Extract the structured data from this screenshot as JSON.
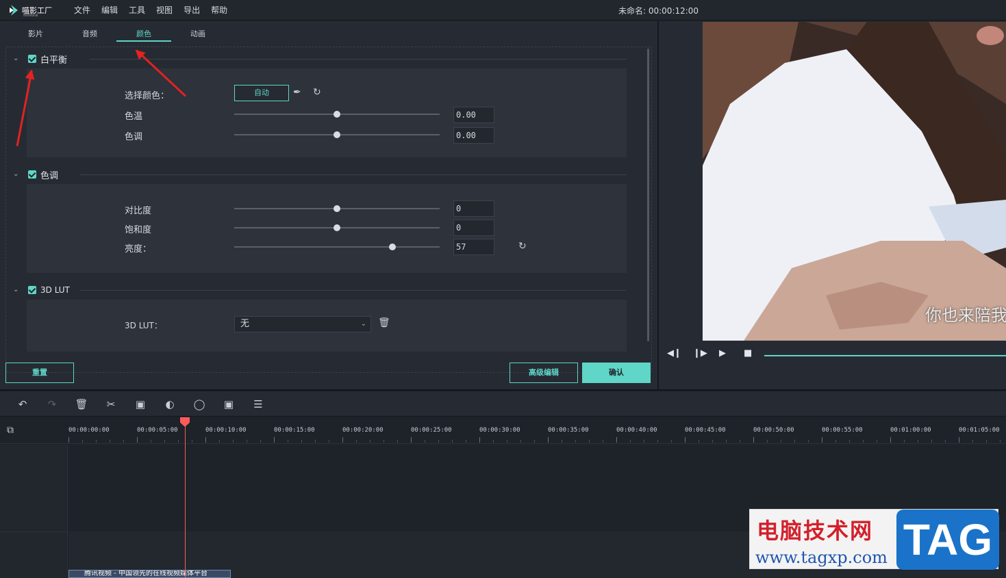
{
  "app": {
    "logo_text": "喵影工厂",
    "logo_sub": "filmora",
    "project_title": "未命名: 00:00:12:00"
  },
  "menu": [
    "文件",
    "编辑",
    "工具",
    "视图",
    "导出",
    "帮助"
  ],
  "tabs": [
    {
      "label": "影片",
      "active": false
    },
    {
      "label": "音频",
      "active": false
    },
    {
      "label": "颜色",
      "active": true
    },
    {
      "label": "动画",
      "active": false
    }
  ],
  "white_balance": {
    "title": "白平衡",
    "checked": true,
    "pick_color_label": "选择颜色：",
    "auto_label": "自动",
    "temperature_label": "色温",
    "temperature_value": "0.00",
    "temperature_level": 0.5,
    "tint_label": "色调",
    "tint_value": "0.00",
    "tint_level": 0.5
  },
  "tone": {
    "title": "色调",
    "checked": true,
    "contrast_label": "对比度",
    "contrast_value": "0",
    "contrast_level": 0.5,
    "saturation_label": "饱和度",
    "saturation_value": "0",
    "saturation_level": 0.5,
    "brightness_label": "亮度：",
    "brightness_value": "57",
    "brightness_level": 0.77
  },
  "lut": {
    "title": "3D LUT",
    "checked": true,
    "label": "3D LUT：",
    "selected": "无"
  },
  "buttons": {
    "reset": "重置",
    "advanced": "高级编辑",
    "confirm": "确认"
  },
  "preview": {
    "subtitle": "你也来陪我"
  },
  "timeline": {
    "timecodes": [
      "00:00:00:00",
      "00:00:05:00",
      "00:00:10:00",
      "00:00:15:00",
      "00:00:20:00",
      "00:00:25:00",
      "00:00:30:00",
      "00:00:35:00",
      "00:00:40:00",
      "00:00:45:00",
      "00:00:50:00",
      "00:00:55:00",
      "00:01:00:00",
      "00:01:05:00"
    ],
    "clip_title": "腾讯视频 - 中国领先的在线视频媒体平台"
  },
  "watermark": {
    "title": "电脑技术网",
    "url": "www.tagxp.com",
    "tag": "TAG"
  },
  "colors": {
    "accent": "#5fd6c7",
    "annotation_arrow": "#e32222",
    "playhead": "#ff5b5b"
  }
}
